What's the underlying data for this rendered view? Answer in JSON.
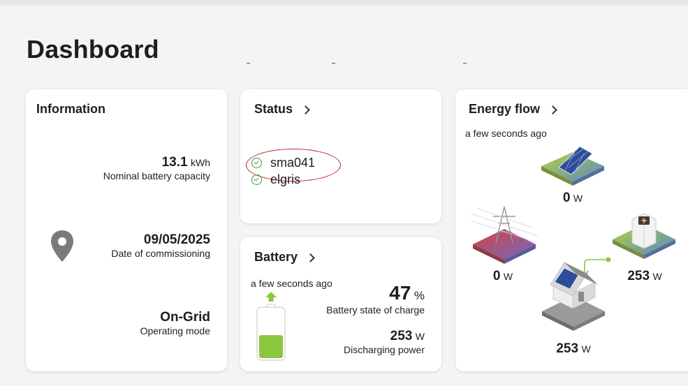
{
  "page": {
    "title": "Dashboard"
  },
  "information": {
    "title": "Information",
    "battery_capacity": {
      "value": "13.1",
      "unit": "kWh",
      "label": "Nominal battery capacity"
    },
    "commissioning": {
      "value": "09/05/2025",
      "label": "Date of commissioning"
    },
    "operating_mode": {
      "value": "On-Grid",
      "label": "Operating mode"
    },
    "icon": "location-pin-icon"
  },
  "status": {
    "title": "Status",
    "devices": [
      {
        "name": "sma041",
        "state": "ok"
      },
      {
        "name": "elgris",
        "state": "ok"
      }
    ]
  },
  "battery": {
    "title": "Battery",
    "updated": "a few seconds ago",
    "soc": {
      "value": "47",
      "unit": "%",
      "label": "Battery state of charge"
    },
    "power": {
      "value": "253",
      "unit": "W",
      "label": "Discharging power"
    },
    "fill_fraction": 0.47
  },
  "energy_flow": {
    "title": "Energy flow",
    "updated": "a few seconds ago",
    "pv": {
      "value": "0",
      "unit": "W"
    },
    "grid": {
      "value": "0",
      "unit": "W"
    },
    "storage": {
      "value": "253",
      "unit": "W"
    },
    "house": {
      "value": "253",
      "unit": "W"
    }
  },
  "colors": {
    "accent_green": "#8cc63f",
    "ok_green": "#3a9a3a",
    "annotation_red": "#c0262d"
  }
}
